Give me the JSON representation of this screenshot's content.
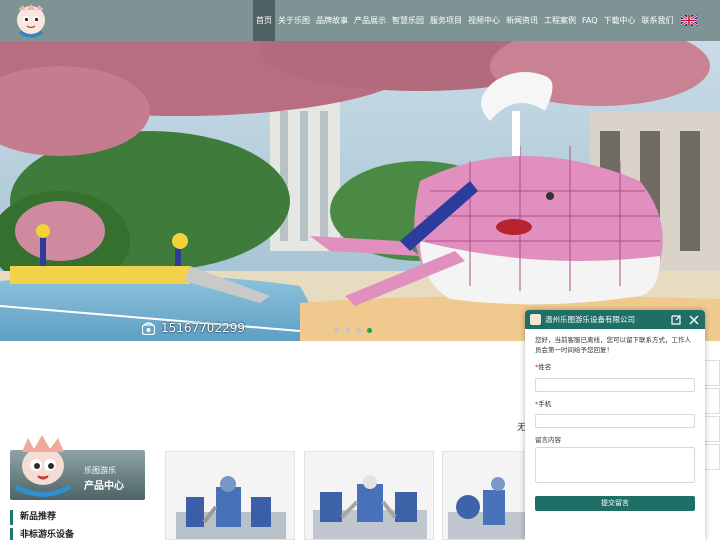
{
  "header": {
    "logo_icon": "mascot-logo-icon",
    "nav": [
      {
        "label": "首页",
        "active": true
      },
      {
        "label": "关于乐图"
      },
      {
        "label": "品牌故事"
      },
      {
        "label": "产品展示"
      },
      {
        "label": "智慧乐园"
      },
      {
        "label": "服务项目"
      },
      {
        "label": "视频中心"
      },
      {
        "label": "新闻资讯"
      },
      {
        "label": "工程案例"
      },
      {
        "label": "FAQ"
      },
      {
        "label": "下载中心"
      },
      {
        "label": "联系我们"
      }
    ],
    "language_icon": "uk-flag-icon"
  },
  "hero": {
    "phone": "15167702299",
    "phone_icon": "phone-icon",
    "slides": 4,
    "active_slide": 4
  },
  "sidebar": {
    "brand": "乐图游乐",
    "title": "产品中心",
    "items": [
      "新品推荐",
      "非标游乐设备"
    ]
  },
  "section_partial_text": "无",
  "chat": {
    "title": "温州乐图游乐设备有限公司",
    "message": "您好，当前客服已离线，您可以留下联系方式，工作人员会第一时间给予您回复！",
    "fields": [
      {
        "label": "姓名",
        "required": true,
        "value": ""
      },
      {
        "label": "手机",
        "required": true,
        "value": ""
      }
    ],
    "textarea_label": "留言内容",
    "submit_label": "提交留言"
  },
  "colors": {
    "header_bg": "#7e9394",
    "nav_active_bg": "#4f6263",
    "chat_accent": "#1f6f66",
    "slider_active_dot": "#1aa34a"
  }
}
